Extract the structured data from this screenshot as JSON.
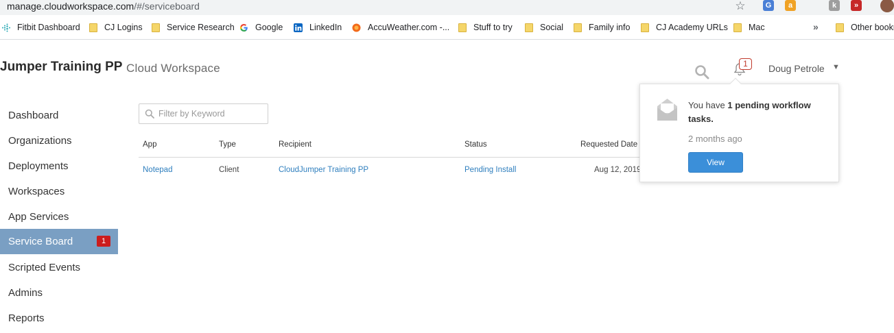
{
  "browser": {
    "url_host": "manage.cloudworkspace.com",
    "url_path": "/#/serviceboard",
    "bookmarks": [
      {
        "label": "Fitbit Dashboard",
        "icon": "fitbit-icon"
      },
      {
        "label": "CJ Logins",
        "icon": "folder-icon"
      },
      {
        "label": "Service Research",
        "icon": "folder-icon"
      },
      {
        "label": "Google",
        "icon": "google-icon"
      },
      {
        "label": "LinkedIn",
        "icon": "linkedin-icon"
      },
      {
        "label": "AccuWeather.com -...",
        "icon": "accuweather-icon"
      },
      {
        "label": "Stuff to try",
        "icon": "folder-icon"
      },
      {
        "label": "Social",
        "icon": "folder-icon"
      },
      {
        "label": "Family info",
        "icon": "folder-icon"
      },
      {
        "label": "CJ Academy URLs",
        "icon": "folder-icon"
      },
      {
        "label": "Mac",
        "icon": "folder-icon"
      }
    ],
    "more_bookmarks": "»",
    "other_bookmarks": "Other bookm"
  },
  "header": {
    "brand": "Jumper Training PP",
    "product": "Cloud Workspace",
    "notification_count": "1",
    "user_name": "Doug Petrole",
    "user_caret": "▼"
  },
  "sidebar": {
    "items": [
      {
        "label": "Dashboard"
      },
      {
        "label": "Organizations"
      },
      {
        "label": "Deployments"
      },
      {
        "label": "Workspaces"
      },
      {
        "label": "App Services"
      },
      {
        "label": "Service Board",
        "badge": "1",
        "active": true
      },
      {
        "label": "Scripted Events"
      },
      {
        "label": "Admins"
      },
      {
        "label": "Reports"
      }
    ]
  },
  "filter": {
    "placeholder": "Filter by Keyword"
  },
  "table": {
    "headers": [
      "App",
      "Type",
      "Recipient",
      "Status",
      "Requested Date"
    ],
    "sort_indicator": "▲",
    "rows": [
      {
        "app": "Notepad",
        "type": "Client",
        "recipient": "CloudJumper Training PP",
        "status": "Pending Install",
        "requested": "Aug 12, 2019"
      }
    ]
  },
  "popover": {
    "prefix": "You have ",
    "emphasis": "1 pending workflow tasks.",
    "time": "2 months ago",
    "button": "View"
  },
  "colors": {
    "accent": "#3b8fd9",
    "sidebar_active": "#7a9fc3",
    "badge": "#cc1d1d",
    "link": "#2f7fbe"
  }
}
